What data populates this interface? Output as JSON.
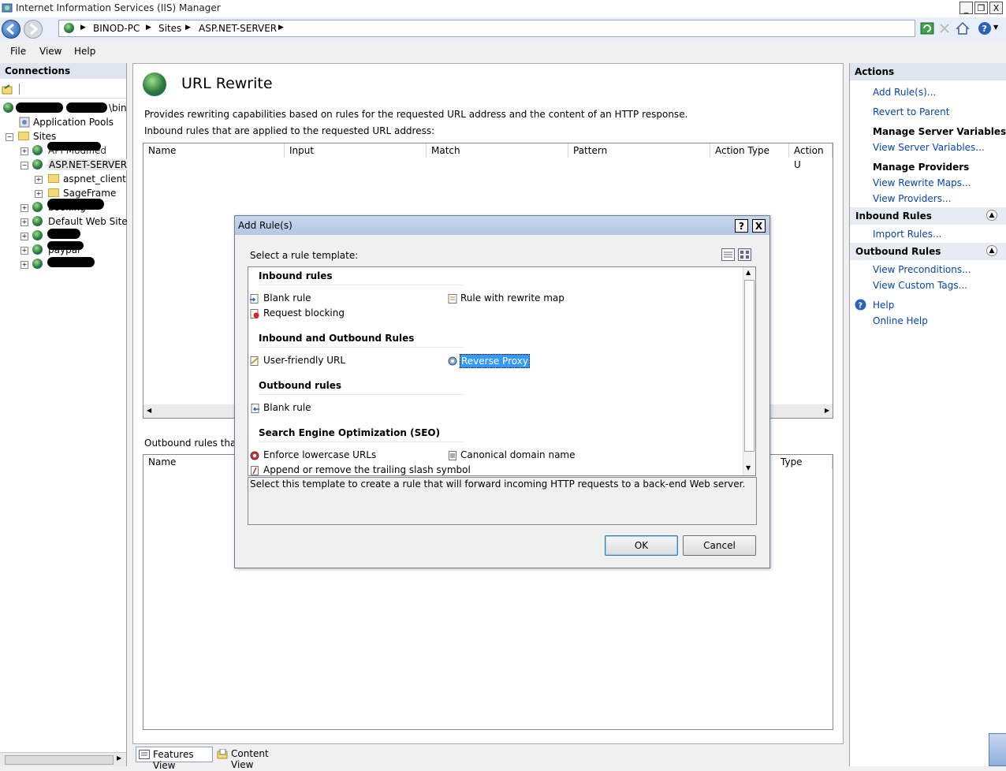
{
  "window": {
    "title": "Internet Information Services (IIS) Manager",
    "controls": {
      "minimize": "_",
      "restore": "❐",
      "close": "X"
    }
  },
  "address_bar": {
    "crumbs": [
      "BINOD-PC",
      "Sites",
      "ASP.NET-SERVER"
    ]
  },
  "menu": [
    "File",
    "View",
    "Help"
  ],
  "connections": {
    "header": "Connections",
    "tree": {
      "root_suffix": "\\bin",
      "application_pools": "Application Pools",
      "sites": "Sites",
      "site_partial_1": "API Modified",
      "active_site": "ASP.NET-SERVER",
      "child_1": "aspnet_client",
      "child_2": "SageFrame",
      "site_partial_2": "booking",
      "default_site": "Default Web Site",
      "site_partial_3": "paypal"
    }
  },
  "main": {
    "title": "URL Rewrite",
    "description": "Provides rewriting capabilities based on rules for the requested URL address and the content of an HTTP response.",
    "inbound_label": "Inbound rules that are applied to the requested URL address:",
    "inbound_columns": [
      "Name",
      "Input",
      "Match",
      "Pattern",
      "Action Type",
      "Action U"
    ],
    "outbound_label": "Outbound rules that a",
    "outbound_columns": [
      "Name",
      "Type"
    ],
    "bottom_tabs": [
      "Features View",
      "Content View"
    ]
  },
  "actions": {
    "header": "Actions",
    "add_rules": "Add Rule(s)...",
    "revert": "Revert to Parent",
    "manage_server_variables": "Manage Server Variables",
    "view_server_variables": "View Server Variables...",
    "manage_providers": "Manage Providers",
    "view_rewrite_maps": "View Rewrite Maps...",
    "view_providers": "View Providers...",
    "inbound_rules": "Inbound Rules",
    "import_rules": "Import Rules...",
    "outbound_rules": "Outbound Rules",
    "view_preconditions": "View Preconditions...",
    "view_custom_tags": "View Custom Tags...",
    "help": "Help",
    "online_help": "Online Help"
  },
  "dialog": {
    "title": "Add Rule(s)",
    "help_btn": "?",
    "close_btn": "X",
    "select_label": "Select a rule template:",
    "sections": {
      "inbound": "Inbound rules",
      "inbound_outbound": "Inbound and Outbound Rules",
      "outbound": "Outbound rules",
      "seo": "Search Engine Optimization (SEO)"
    },
    "items": {
      "blank_rule": "Blank rule",
      "rule_with_rewrite_map": "Rule with rewrite map",
      "request_blocking": "Request blocking",
      "user_friendly_url": "User-friendly URL",
      "reverse_proxy": "Reverse Proxy",
      "outbound_blank_rule": "Blank rule",
      "enforce_lowercase": "Enforce lowercase URLs",
      "canonical_domain": "Canonical domain name",
      "trailing_slash": "Append or remove the trailing slash symbol"
    },
    "selected_item": "Reverse Proxy",
    "selection_color": "#3399ff",
    "description": "Select this template to create a rule that will forward incoming HTTP requests to a back-end Web server.",
    "ok": "OK",
    "cancel": "Cancel"
  }
}
